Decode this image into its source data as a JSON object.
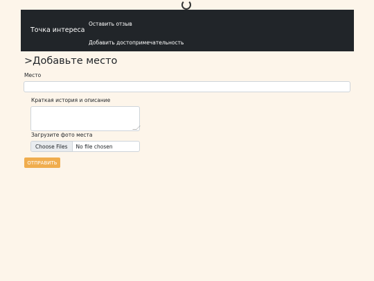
{
  "nav": {
    "brand": "Точка интереса",
    "links": [
      "Оставить отзыв",
      "Добавить достопримечательность"
    ]
  },
  "page": {
    "title": ">Добавьте место"
  },
  "form": {
    "place_label": "Место",
    "place_value": "",
    "story_label": "Краткая история и описание",
    "story_value": "",
    "photo_label": "Загрузите фото места",
    "file_button": "Choose Files",
    "file_status": "No file chosen",
    "submit": "ОТПРАВИТЬ"
  },
  "colors": {
    "background": "#fdf5ea",
    "navbar": "#212529",
    "submit": "#f0ad4e"
  },
  "icons": {
    "loading": "loading-spinner-icon"
  }
}
